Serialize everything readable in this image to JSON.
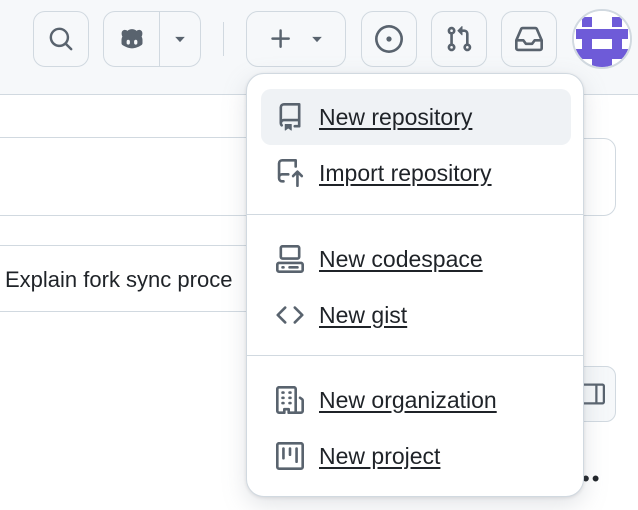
{
  "header": {
    "search_icon": "search-icon",
    "copilot_icon": "copilot-icon",
    "create_icon": "plus-icon",
    "issues_icon": "issue-opened-icon",
    "pulls_icon": "git-pull-request-icon",
    "inbox_icon": "inbox-icon",
    "avatar_color": "#6e5bd8"
  },
  "background": {
    "text": "Explain fork sync proce"
  },
  "menu": {
    "items": [
      {
        "label": "New repository",
        "icon": "repo-icon"
      },
      {
        "label": "Import repository",
        "icon": "repo-push-icon"
      },
      {
        "label": "New codespace",
        "icon": "codespaces-icon"
      },
      {
        "label": "New gist",
        "icon": "code-icon"
      },
      {
        "label": "New organization",
        "icon": "organization-icon"
      },
      {
        "label": "New project",
        "icon": "project-icon"
      }
    ]
  },
  "colors": {
    "border": "#d1d9e0",
    "icon": "#59636e",
    "text": "#1f2328",
    "hover_bg": "#eff2f5"
  }
}
